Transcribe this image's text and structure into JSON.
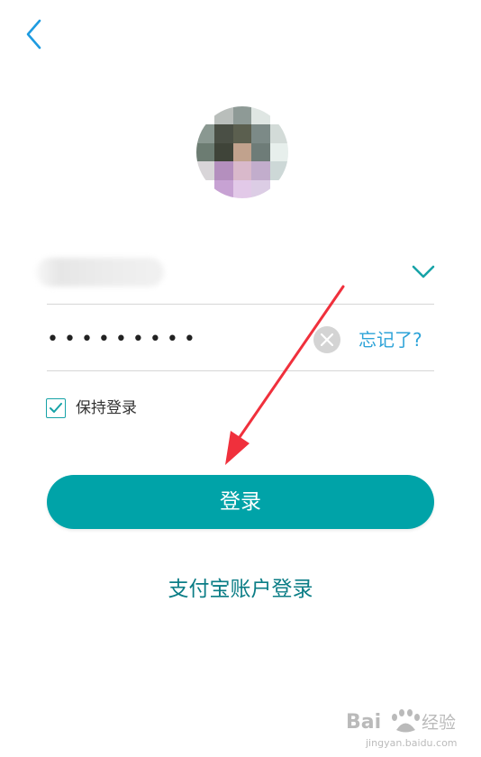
{
  "header": {
    "back_icon": "chevron-left-icon"
  },
  "avatar": {
    "pixels": [
      "#ffffff",
      "#b9bebb",
      "#8e9a96",
      "#dfe6e3",
      "#ffffff",
      "#8a9891",
      "#4a4f45",
      "#5b5f4f",
      "#7c8a87",
      "#d3dbd8",
      "#6c7c72",
      "#3f4439",
      "#c1a28d",
      "#6e7c78",
      "#e7efec",
      "#d8d5d8",
      "#b48fbe",
      "#d9b9cb",
      "#c2adcc",
      "#cdd8d7",
      "#ffffff",
      "#c7a2d3",
      "#e2c9e8",
      "#dccde5",
      "#ffffff"
    ]
  },
  "account": {
    "dropdown_icon": "chevron-down-icon"
  },
  "password": {
    "masked_value": "•••••••••",
    "clear_icon": "clear-icon"
  },
  "forgot_label": "忘记了?",
  "remember": {
    "label": "保持登录",
    "checked": true
  },
  "login_button_label": "登录",
  "alipay_login_label": "支付宝账户登录",
  "colors": {
    "accent": "#00a3a8",
    "link_blue": "#2da3d8",
    "alipay_text": "#0b7d86",
    "annotation_arrow": "#f0303c"
  },
  "watermark": {
    "brand": "Bai",
    "suffix": "经验",
    "url": "jingyan.baidu.com"
  }
}
